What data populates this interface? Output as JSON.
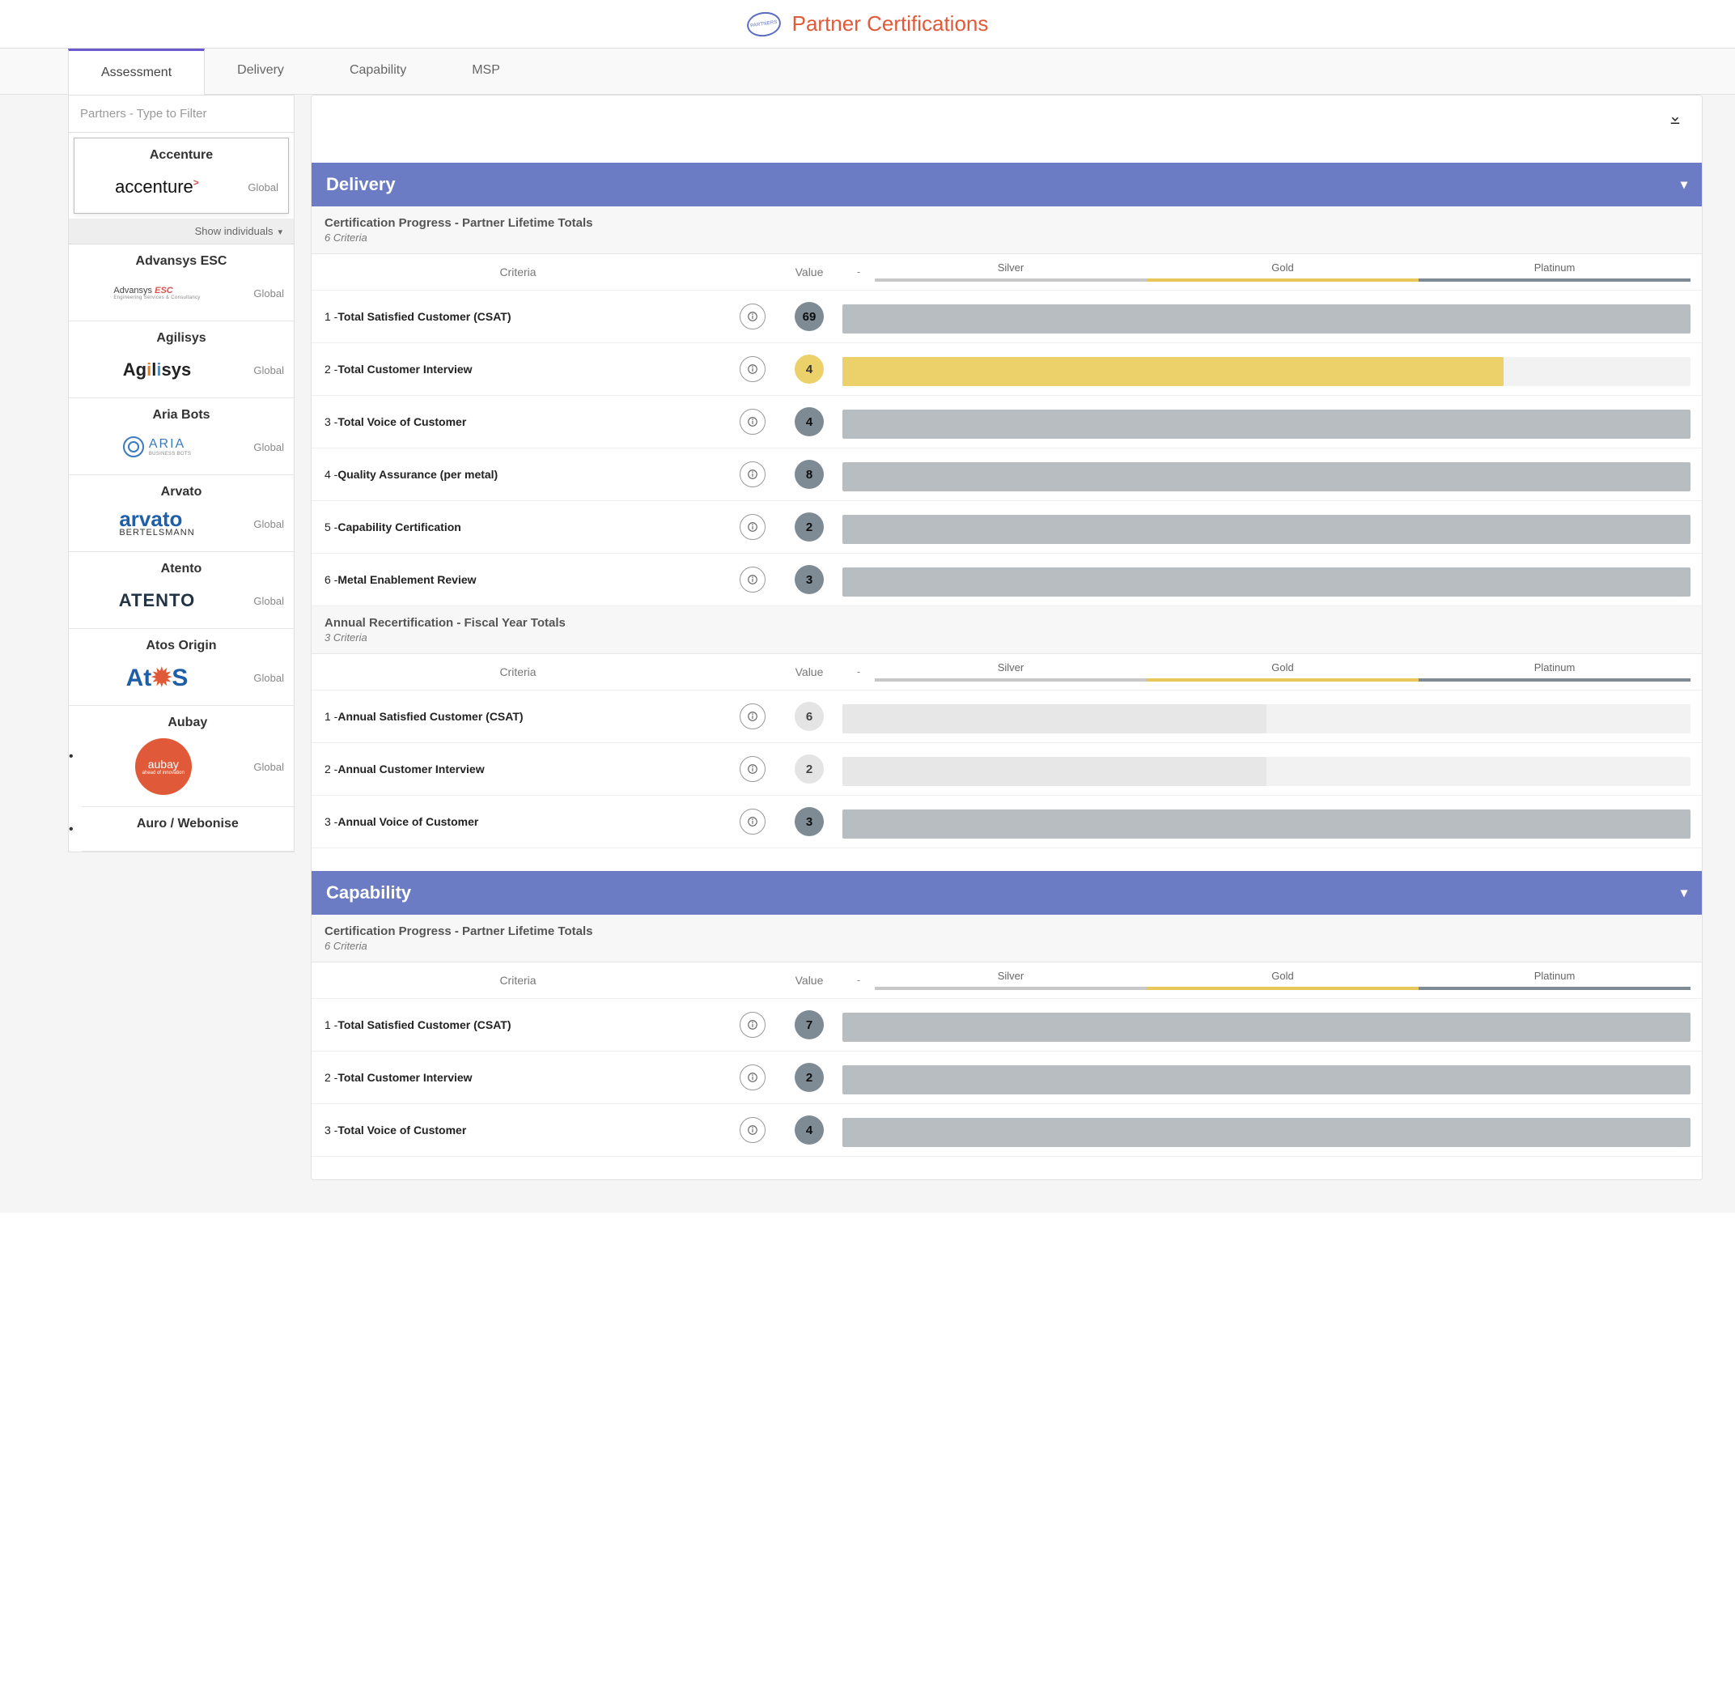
{
  "header": {
    "title": "Partner Certifications",
    "logo_text": "PARTNERS"
  },
  "tabs": [
    {
      "label": "Assessment",
      "active": true
    },
    {
      "label": "Delivery"
    },
    {
      "label": "Capability"
    },
    {
      "label": "MSP"
    }
  ],
  "sidebar": {
    "filter_placeholder": "Partners - Type to Filter",
    "show_individuals": "Show individuals",
    "items": [
      {
        "name": "Accenture",
        "scope": "Global",
        "logo": "accenture",
        "active": true
      },
      {
        "name": "Advansys ESC",
        "scope": "Global",
        "logo": "advansys"
      },
      {
        "name": "Agilisys",
        "scope": "Global",
        "logo": "agilisys"
      },
      {
        "name": "Aria Bots",
        "scope": "Global",
        "logo": "aria"
      },
      {
        "name": "Arvato",
        "scope": "Global",
        "logo": "arvato"
      },
      {
        "name": "Atento",
        "scope": "Global",
        "logo": "atento"
      },
      {
        "name": "Atos Origin",
        "scope": "Global",
        "logo": "atos"
      },
      {
        "name": "Aubay",
        "scope": "Global",
        "logo": "aubay",
        "bulleted": true
      },
      {
        "name": "Auro / Webonise",
        "scope": "",
        "logo": "none",
        "bulleted": true
      }
    ]
  },
  "columns": {
    "criteria": "Criteria",
    "value": "Value",
    "dash": "-",
    "tiers": [
      "Silver",
      "Gold",
      "Platinum"
    ]
  },
  "sections": [
    {
      "title": "Delivery",
      "groups": [
        {
          "title": "Certification Progress - Partner Lifetime Totals",
          "subtitle": "6 Criteria",
          "scale_style": "lifetime",
          "rows": [
            {
              "idx": "1",
              "name": "Total Satisfied Customer (CSAT)",
              "value": "69",
              "badge": "grey",
              "bar": "full",
              "fillpct": 100
            },
            {
              "idx": "2",
              "name": "Total Customer Interview",
              "value": "4",
              "badge": "gold",
              "bar": "gold",
              "fillpct": 78
            },
            {
              "idx": "3",
              "name": "Total Voice of Customer",
              "value": "4",
              "badge": "grey",
              "bar": "full",
              "fillpct": 100
            },
            {
              "idx": "4",
              "name": "Quality Assurance (per metal)",
              "value": "8",
              "badge": "grey",
              "bar": "full",
              "fillpct": 100
            },
            {
              "idx": "5",
              "name": "Capability Certification",
              "value": "2",
              "badge": "grey",
              "bar": "full",
              "fillpct": 100
            },
            {
              "idx": "6",
              "name": "Metal Enablement Review",
              "value": "3",
              "badge": "grey",
              "bar": "full",
              "fillpct": 100
            }
          ]
        },
        {
          "title": "Annual Recertification - Fiscal Year Totals",
          "subtitle": "3 Criteria",
          "scale_style": "annual",
          "rows": [
            {
              "idx": "1",
              "name": "Annual Satisfied Customer (CSAT)",
              "value": "6",
              "badge": "light",
              "bar": "light",
              "fillpct": 50
            },
            {
              "idx": "2",
              "name": "Annual Customer Interview",
              "value": "2",
              "badge": "light",
              "bar": "light",
              "fillpct": 50
            },
            {
              "idx": "3",
              "name": "Annual Voice of Customer",
              "value": "3",
              "badge": "grey",
              "bar": "full",
              "fillpct": 100
            }
          ]
        }
      ]
    },
    {
      "title": "Capability",
      "groups": [
        {
          "title": "Certification Progress - Partner Lifetime Totals",
          "subtitle": "6 Criteria",
          "scale_style": "lifetime",
          "rows": [
            {
              "idx": "1",
              "name": "Total Satisfied Customer (CSAT)",
              "value": "7",
              "badge": "grey",
              "bar": "full",
              "fillpct": 100
            },
            {
              "idx": "2",
              "name": "Total Customer Interview",
              "value": "2",
              "badge": "grey",
              "bar": "full",
              "fillpct": 100
            },
            {
              "idx": "3",
              "name": "Total Voice of Customer",
              "value": "4",
              "badge": "grey",
              "bar": "full",
              "fillpct": 100
            }
          ]
        }
      ]
    }
  ]
}
